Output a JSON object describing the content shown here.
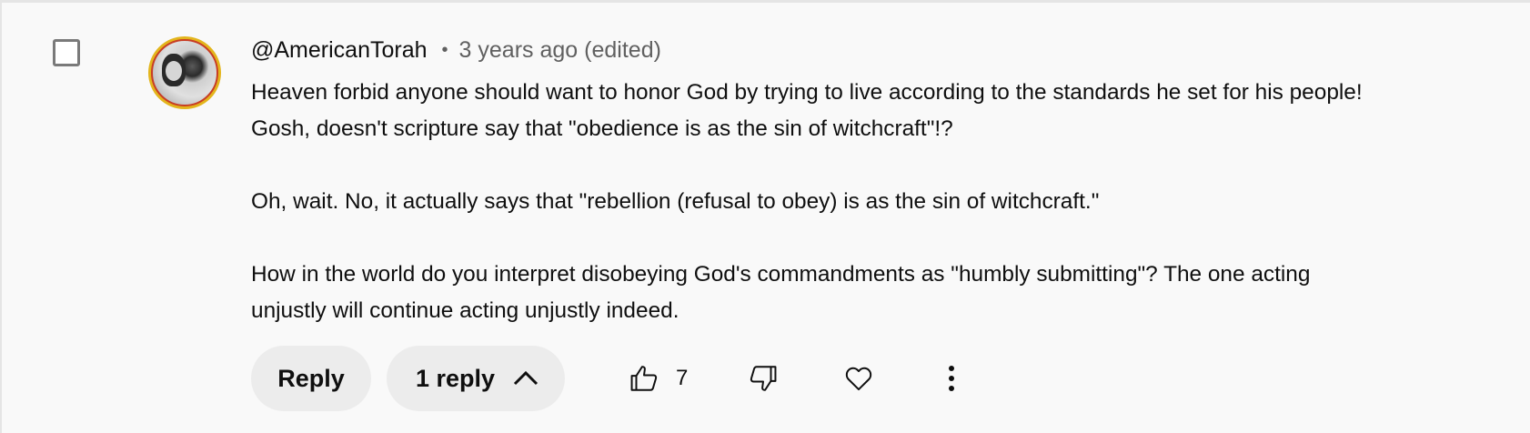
{
  "comment": {
    "author": "@AmericanTorah",
    "separator": "•",
    "time": "3 years ago",
    "edited": "(edited)",
    "body": "Heaven forbid anyone should want to honor God by trying to live according to the standards he set for his people!\nGosh, doesn't scripture say that \"obedience is as the sin of witchcraft\"!?\n\nOh, wait. No, it actually says that \"rebellion (refusal to obey) is as the sin of witchcraft.\"\n\nHow in the world do you interpret disobeying God's commandments as \"humbly submitting\"? The one acting\nunjustly will continue acting unjustly indeed."
  },
  "actions": {
    "reply_label": "Reply",
    "replies_label": "1 reply",
    "like_count": "7"
  },
  "icons": {
    "checkbox": "checkbox-icon",
    "avatar": "avatar-image",
    "chevron": "chevron-up-icon",
    "like": "thumbs-up-icon",
    "dislike": "thumbs-down-icon",
    "heart": "heart-icon",
    "more": "more-vertical-icon"
  },
  "colors": {
    "background": "#f9f9f9",
    "pill": "#ececec",
    "secondary_text": "#606060",
    "avatar_ring": "#e3b51c"
  }
}
